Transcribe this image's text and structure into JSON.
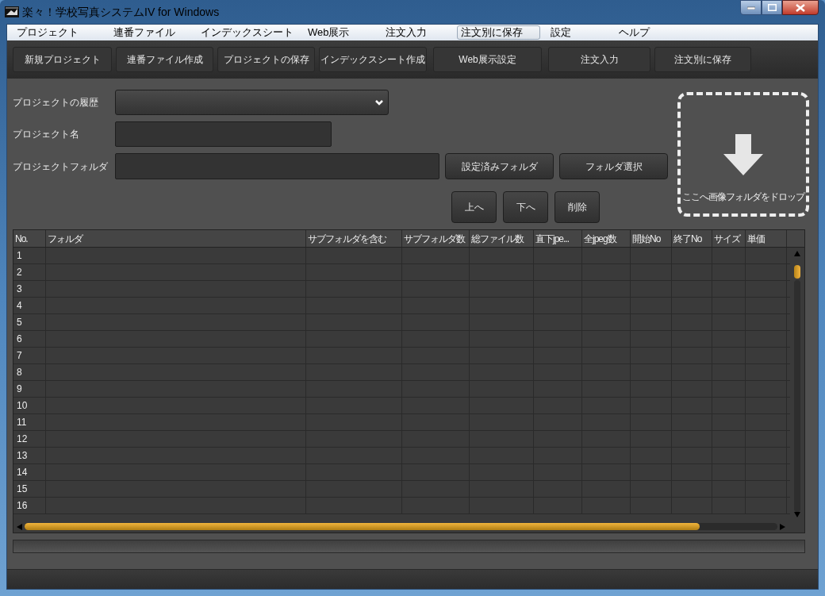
{
  "window": {
    "title": "楽々！学校写真システムIV for Windows"
  },
  "menu": [
    {
      "label": "プロジェクト",
      "highlighted": false
    },
    {
      "label": "連番ファイル",
      "highlighted": false
    },
    {
      "label": "インデックスシート",
      "highlighted": false
    },
    {
      "label": "Web展示",
      "highlighted": false
    },
    {
      "label": "注文入力",
      "highlighted": false
    },
    {
      "label": "注文別に保存",
      "highlighted": true
    },
    {
      "label": "設定",
      "highlighted": false
    },
    {
      "label": "ヘルプ",
      "highlighted": false
    }
  ],
  "toolbar": [
    "新規プロジェクト",
    "連番ファイル作成",
    "プロジェクトの保存",
    "インデックスシート作成",
    "Web展示設定",
    "注文入力",
    "注文別に保存"
  ],
  "form": {
    "history_label": "プロジェクトの履歴",
    "name_label": "プロジェクト名",
    "folder_label": "プロジェクトフォルダ",
    "folder_buttons": [
      "設定済みフォルダ",
      "フォルダ選択"
    ],
    "order_buttons": [
      "上へ",
      "下へ",
      "削除"
    ]
  },
  "drop_zone": {
    "label": "ここへ画像フォルダをドロップ"
  },
  "progress": {
    "level": 0
  },
  "table": {
    "columns": [
      "No.",
      "フォルダ",
      "サブフォルダを含む",
      "サブフォルダ数",
      "総ファイル数",
      "直下jpe...",
      "全jpeg数",
      "開始No",
      "終了No",
      "サイズ",
      "単価"
    ],
    "rows": [
      "1",
      "2",
      "3",
      "4",
      "5",
      "6",
      "7",
      "8",
      "9",
      "10",
      "11",
      "12",
      "13",
      "14",
      "15",
      "16"
    ]
  }
}
